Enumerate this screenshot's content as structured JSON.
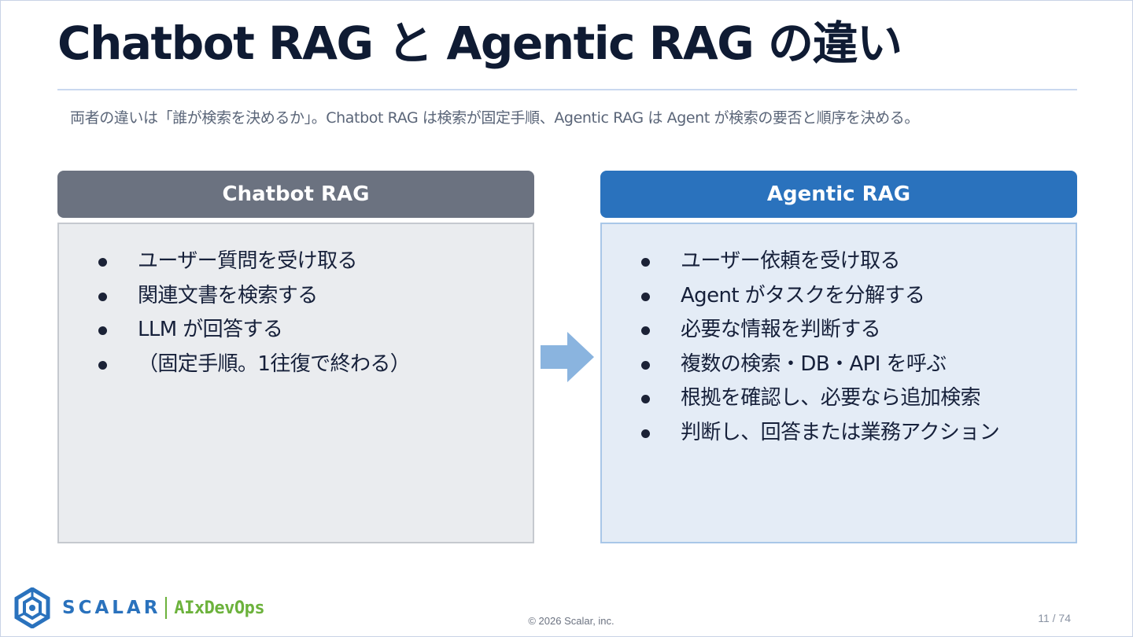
{
  "slide": {
    "title": "Chatbot RAG と Agentic RAG の違い",
    "subtitle": "両者の違いは「誰が検索を決めるか」。Chatbot RAG は検索が固定手順、Agentic RAG は Agent が検索の要否と順序を決める。"
  },
  "left_panel": {
    "heading": "Chatbot RAG",
    "items": [
      "ユーザー質問を受け取る",
      "関連文書を検索する",
      "LLM が回答する",
      "（固定手順。1往復で終わる）"
    ]
  },
  "right_panel": {
    "heading": "Agentic RAG",
    "items": [
      "ユーザー依頼を受け取る",
      "Agent がタスクを分解する",
      "必要な情報を判断する",
      "複数の検索・DB・API を呼ぶ",
      "根拠を確認し、必要なら追加検索",
      "判断し、回答または業務アクション"
    ]
  },
  "footer": {
    "logo_name": "SCALAR",
    "logo_tag": "AIxDevOps",
    "copyright": "© 2026 Scalar, inc.",
    "page": "11 / 74"
  },
  "colors": {
    "left_header": "#6b7280",
    "right_header": "#2a72bd",
    "arrow": "#8ab4df",
    "brand_blue": "#2a72bd",
    "brand_green": "#6cb23c"
  },
  "icons": {
    "arrow": "right-arrow-icon",
    "logo": "scalar-logo-icon",
    "bullet": "bullet-dot-icon"
  }
}
